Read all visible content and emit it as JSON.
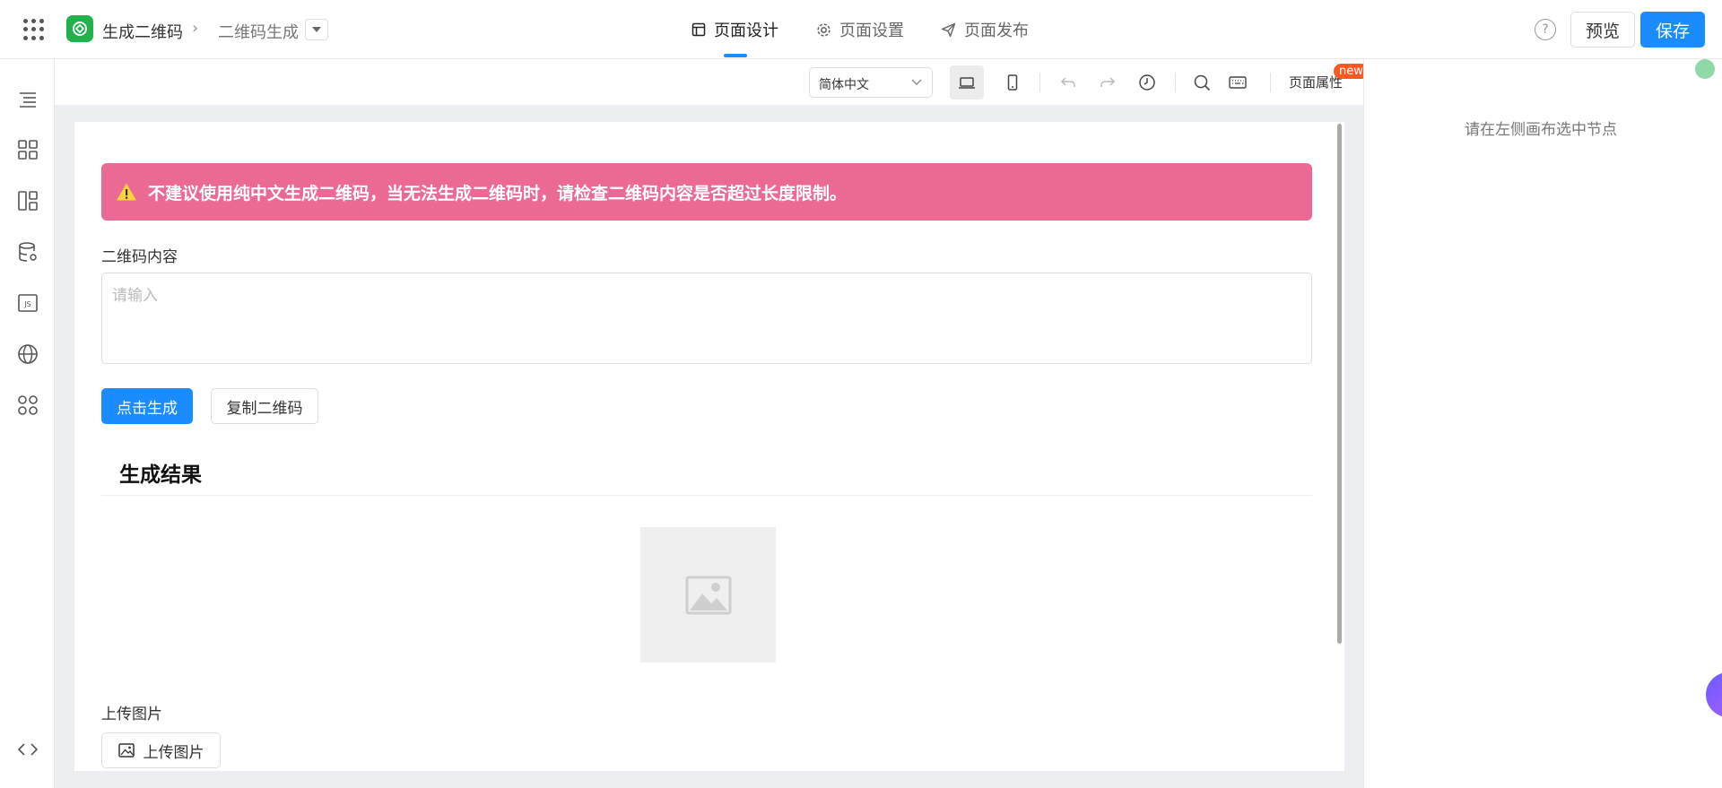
{
  "header": {
    "app_name": "生成二维码",
    "breadcrumb_sep": "›",
    "page_name": "二维码生成",
    "tabs": [
      {
        "label": "页面设计",
        "icon": "layout-icon",
        "active": true
      },
      {
        "label": "页面设置",
        "icon": "gear-icon",
        "active": false
      },
      {
        "label": "页面发布",
        "icon": "send-icon",
        "active": false
      }
    ],
    "help_symbol": "?",
    "preview_label": "预览",
    "save_label": "保存",
    "accent_color": "#1a8cff"
  },
  "left_rail": {
    "items": [
      {
        "name": "outline-icon"
      },
      {
        "name": "components-grid-icon"
      },
      {
        "name": "templates-icon"
      },
      {
        "name": "datasource-icon"
      },
      {
        "name": "js-code-icon"
      },
      {
        "name": "globe-icon"
      },
      {
        "name": "apps-icon"
      }
    ],
    "bottom": {
      "name": "code-view-icon",
      "label": "< >"
    }
  },
  "toolbar": {
    "language": "简体中文",
    "page_props_label": "页面属性",
    "new_badge": "new",
    "tools": [
      "desktop-icon",
      "mobile-icon",
      "undo-icon",
      "redo-icon",
      "history-icon",
      "search-icon",
      "keyboard-icon"
    ]
  },
  "canvas": {
    "alert_text": "不建议使用纯中文生成二维码，当无法生成二维码时，请检查二维码内容是否超过长度限制。",
    "alert_color": "#ea6a93",
    "content_label": "二维码内容",
    "content_placeholder": "请输入",
    "generate_button": "点击生成",
    "copy_button": "复制二维码",
    "result_title": "生成结果",
    "upload_label": "上传图片",
    "upload_button": "上传图片"
  },
  "right_panel": {
    "hint": "请在左侧画布选中节点"
  }
}
